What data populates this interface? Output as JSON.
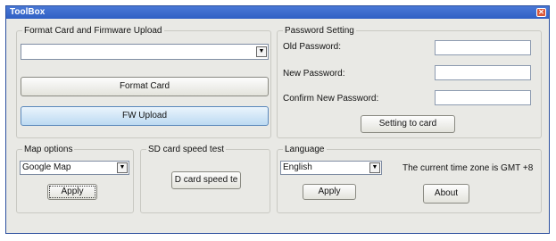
{
  "window": {
    "title": "ToolBox"
  },
  "format_group": {
    "legend": "Format Card and Firmware Upload",
    "select_value": "",
    "format_button": "Format Card",
    "fw_button": "FW Upload"
  },
  "password_group": {
    "legend": "Password Setting",
    "old_label": "Old Password:",
    "new_label": "New Password:",
    "confirm_label": "Confirm New Password:",
    "old_value": "",
    "new_value": "",
    "confirm_value": "",
    "set_button": "Setting to card"
  },
  "map_group": {
    "legend": "Map options",
    "selected": "Google Map",
    "apply_button": "Apply"
  },
  "sd_group": {
    "legend": "SD card speed test",
    "button": "D card speed te"
  },
  "language_group": {
    "legend": "Language",
    "selected": "English",
    "apply_button": "Apply"
  },
  "timezone": {
    "text": "The current time zone is GMT +8",
    "about_button": "About"
  },
  "colors": {
    "titlebar": "#2f5fc4",
    "window_bg": "#e9e9e5",
    "fw_button_bg": "#bcdaf2"
  }
}
